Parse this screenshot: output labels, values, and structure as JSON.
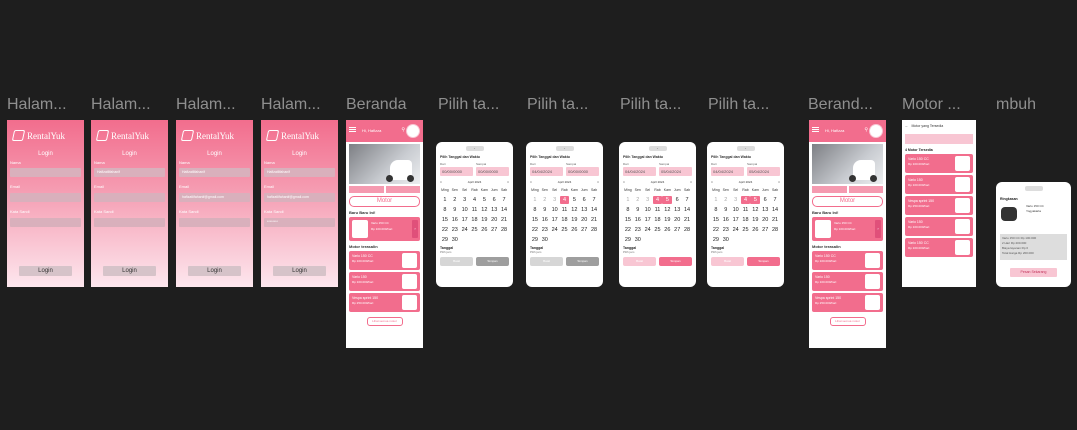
{
  "labels": [
    "Halam...",
    "Halam...",
    "Halam...",
    "Halam...",
    "Beranda",
    "Pilih ta...",
    "Pilih ta...",
    "Pilih ta...",
    "Pilih ta...",
    "Berand...",
    "Motor ...",
    "mbuh"
  ],
  "colors": {
    "canvas": "#1e1e1e",
    "accent": "#f26d8d",
    "accent_light": "#f8c6d3",
    "label": "#8f8f8f"
  },
  "login": {
    "brand": "RentalYuk",
    "title": "Login",
    "f_name": "Nama",
    "f_email": "Email",
    "f_pass": "Kata Sandi",
    "button": "Login",
    "name_val": "Hafizatlifahanif",
    "email_val": "hafizatlifahanif@gmail.com",
    "pass_val": "********"
  },
  "home": {
    "greet": "Hi, Hafizza",
    "motor_pill": "Motor",
    "new_title": "Baru Baru Ini!",
    "fav_title": "Motor terasalin",
    "more": "Lihat semua motor",
    "new_card": {
      "name": "Vario 150 CC",
      "sub": "Rp 100.000/hari"
    },
    "cards": [
      {
        "name": "Vario 150 CC",
        "sub": "Rp 100.000/hari"
      },
      {
        "name": "Vario 150",
        "sub": "Rp 100.000/hari"
      },
      {
        "name": "Vespa sprint 150",
        "sub": "Rp 250.000/hari"
      }
    ]
  },
  "picker": {
    "title": "Pilih Tanggal dan Waktu",
    "sub": "Tanggal",
    "from_lbl": "Dari",
    "to_lbl": "Sampai",
    "month": "April 2024",
    "weekdays": [
      "Ming",
      "Sen",
      "Sel",
      "Rab",
      "Kam",
      "Jum",
      "Sab"
    ],
    "time_lbl": "Tanggal",
    "time_sub": "Pilih jam",
    "cancel": "Batal",
    "ok": "Simpan",
    "dates": [
      {
        "from": "00/00/0000",
        "to": "00/00/0000"
      },
      {
        "from": "04/04/2024",
        "to": "00/00/0000"
      },
      {
        "from": "04/04/2024",
        "to": "05/04/2024"
      },
      {
        "from": "04/04/2024",
        "to": "05/04/2024"
      }
    ]
  },
  "list": {
    "title": "Motor yang Tersedia",
    "count": "4 Motor Tersedia"
  },
  "detail": {
    "title": "Ringkasan",
    "name": "Vario 150 CC",
    "loc": "Yogyakarta",
    "rows": [
      "Vario 150 CC   Rp 100.000",
      "2 Hari   Rp 200.000",
      "Biaya layanan   Rp 0"
    ],
    "total": "Total Harga   Rp 200.000",
    "button": "Pesan Sekarang"
  }
}
